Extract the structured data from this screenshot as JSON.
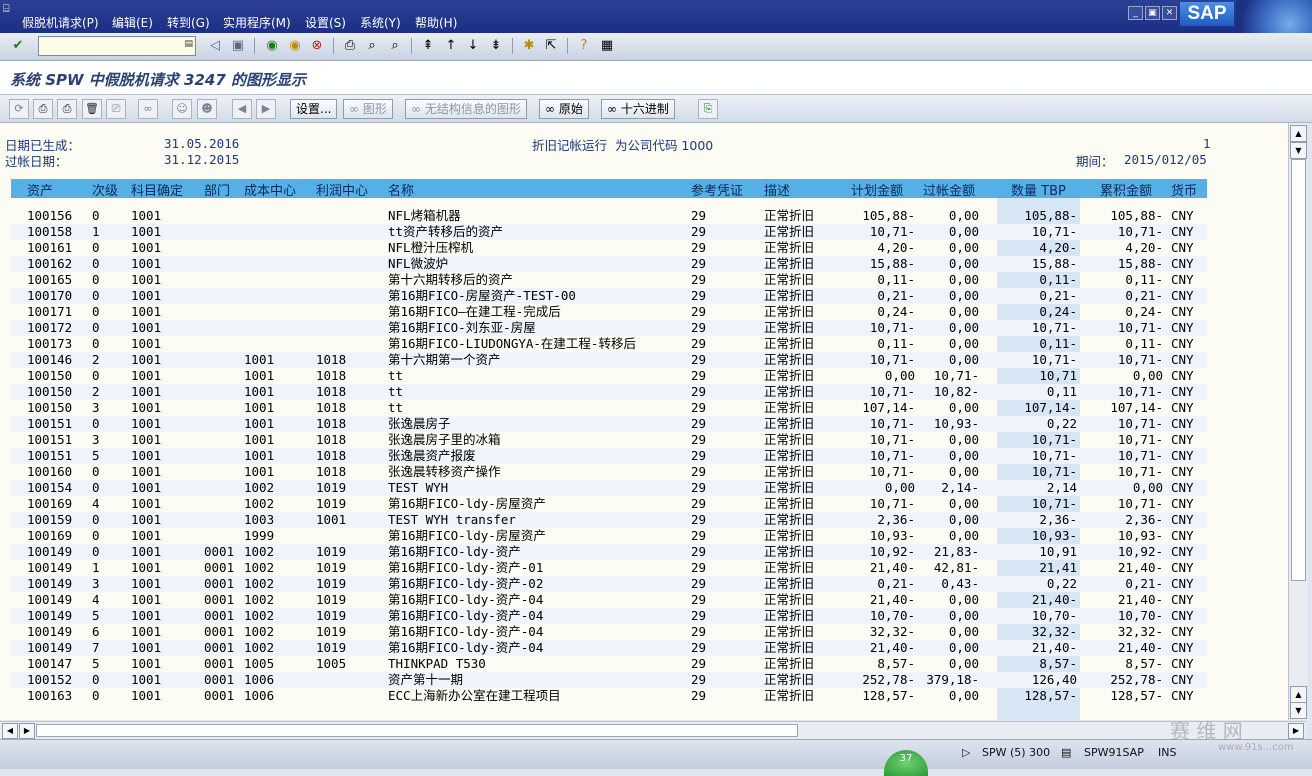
{
  "menu": [
    "假脱机请求(P)",
    "编辑(E)",
    "转到(G)",
    "实用程序(M)",
    "设置(S)",
    "系统(Y)",
    "帮助(H)"
  ],
  "brand": "SAP",
  "command_field": {
    "value": ""
  },
  "page_title": "系统 SPW 中假脱机请求 3247 的图形显示",
  "app_toolbar": {
    "settings": "设置...",
    "graphic": "图形",
    "graphic_no_struct": "无结构信息的图形",
    "raw": "原始",
    "hex": "十六进制"
  },
  "report_header": {
    "created_label": "日期已生成：",
    "created_value": "31.05.2016",
    "posting_label": "过帐日期：",
    "posting_value": "31.12.2015",
    "run_title": "折旧记帐运行  为公司代码 1000",
    "page_no": "1",
    "period_label": "期间：",
    "period_value": "2015/012/05"
  },
  "columns": [
    "资产",
    "次级",
    "科目确定",
    "部门",
    "成本中心",
    "利润中心",
    "名称",
    "参考凭证",
    "描述",
    "计划金额",
    "过帐金额",
    "数量 TBP",
    "累积金额",
    "货币"
  ],
  "rows": [
    [
      "100156",
      "0",
      "1001",
      "",
      "",
      "",
      "NFL烤箱机器",
      "29",
      "正常折旧",
      "105,88-",
      "0,00",
      "105,88-",
      "105,88-",
      "CNY"
    ],
    [
      "100158",
      "1",
      "1001",
      "",
      "",
      "",
      "tt资产转移后的资产",
      "29",
      "正常折旧",
      "10,71-",
      "0,00",
      "10,71-",
      "10,71-",
      "CNY"
    ],
    [
      "100161",
      "0",
      "1001",
      "",
      "",
      "",
      "NFL橙汁压榨机",
      "29",
      "正常折旧",
      "4,20-",
      "0,00",
      "4,20-",
      "4,20-",
      "CNY"
    ],
    [
      "100162",
      "0",
      "1001",
      "",
      "",
      "",
      "NFL微波炉",
      "29",
      "正常折旧",
      "15,88-",
      "0,00",
      "15,88-",
      "15,88-",
      "CNY"
    ],
    [
      "100165",
      "0",
      "1001",
      "",
      "",
      "",
      "第十六期转移后的资产",
      "29",
      "正常折旧",
      "0,11-",
      "0,00",
      "0,11-",
      "0,11-",
      "CNY"
    ],
    [
      "100170",
      "0",
      "1001",
      "",
      "",
      "",
      "第16期FICO-房屋资产-TEST-00",
      "29",
      "正常折旧",
      "0,21-",
      "0,00",
      "0,21-",
      "0,21-",
      "CNY"
    ],
    [
      "100171",
      "0",
      "1001",
      "",
      "",
      "",
      "第16期FICO—在建工程-完成后",
      "29",
      "正常折旧",
      "0,24-",
      "0,00",
      "0,24-",
      "0,24-",
      "CNY"
    ],
    [
      "100172",
      "0",
      "1001",
      "",
      "",
      "",
      "第16期FICO-刘东亚-房屋",
      "29",
      "正常折旧",
      "10,71-",
      "0,00",
      "10,71-",
      "10,71-",
      "CNY"
    ],
    [
      "100173",
      "0",
      "1001",
      "",
      "",
      "",
      "第16期FICO-LIUDONGYA-在建工程-转移后",
      "29",
      "正常折旧",
      "0,11-",
      "0,00",
      "0,11-",
      "0,11-",
      "CNY"
    ],
    [
      "100146",
      "2",
      "1001",
      "",
      "1001",
      "1018",
      "第十六期第一个资产",
      "29",
      "正常折旧",
      "10,71-",
      "0,00",
      "10,71-",
      "10,71-",
      "CNY"
    ],
    [
      "100150",
      "0",
      "1001",
      "",
      "1001",
      "1018",
      "tt",
      "29",
      "正常折旧",
      "0,00",
      "10,71-",
      "10,71",
      "0,00",
      "CNY"
    ],
    [
      "100150",
      "2",
      "1001",
      "",
      "1001",
      "1018",
      "tt",
      "29",
      "正常折旧",
      "10,71-",
      "10,82-",
      "0,11",
      "10,71-",
      "CNY"
    ],
    [
      "100150",
      "3",
      "1001",
      "",
      "1001",
      "1018",
      "tt",
      "29",
      "正常折旧",
      "107,14-",
      "0,00",
      "107,14-",
      "107,14-",
      "CNY"
    ],
    [
      "100151",
      "0",
      "1001",
      "",
      "1001",
      "1018",
      "张逸晨房子",
      "29",
      "正常折旧",
      "10,71-",
      "10,93-",
      "0,22",
      "10,71-",
      "CNY"
    ],
    [
      "100151",
      "3",
      "1001",
      "",
      "1001",
      "1018",
      "张逸晨房子里的冰箱",
      "29",
      "正常折旧",
      "10,71-",
      "0,00",
      "10,71-",
      "10,71-",
      "CNY"
    ],
    [
      "100151",
      "5",
      "1001",
      "",
      "1001",
      "1018",
      "张逸晨资产报废",
      "29",
      "正常折旧",
      "10,71-",
      "0,00",
      "10,71-",
      "10,71-",
      "CNY"
    ],
    [
      "100160",
      "0",
      "1001",
      "",
      "1001",
      "1018",
      "张逸晨转移资产操作",
      "29",
      "正常折旧",
      "10,71-",
      "0,00",
      "10,71-",
      "10,71-",
      "CNY"
    ],
    [
      "100154",
      "0",
      "1001",
      "",
      "1002",
      "1019",
      "TEST WYH",
      "29",
      "正常折旧",
      "0,00",
      "2,14-",
      "2,14",
      "0,00",
      "CNY"
    ],
    [
      "100169",
      "4",
      "1001",
      "",
      "1002",
      "1019",
      "第16期FICO-ldy-房屋资产",
      "29",
      "正常折旧",
      "10,71-",
      "0,00",
      "10,71-",
      "10,71-",
      "CNY"
    ],
    [
      "100159",
      "0",
      "1001",
      "",
      "1003",
      "1001",
      "TEST WYH transfer",
      "29",
      "正常折旧",
      "2,36-",
      "0,00",
      "2,36-",
      "2,36-",
      "CNY"
    ],
    [
      "100169",
      "0",
      "1001",
      "",
      "1999",
      "",
      "第16期FICO-ldy-房屋资产",
      "29",
      "正常折旧",
      "10,93-",
      "0,00",
      "10,93-",
      "10,93-",
      "CNY"
    ],
    [
      "100149",
      "0",
      "1001",
      "0001",
      "1002",
      "1019",
      "第16期FICO-ldy-资产",
      "29",
      "正常折旧",
      "10,92-",
      "21,83-",
      "10,91",
      "10,92-",
      "CNY"
    ],
    [
      "100149",
      "1",
      "1001",
      "0001",
      "1002",
      "1019",
      "第16期FICO-ldy-资产-01",
      "29",
      "正常折旧",
      "21,40-",
      "42,81-",
      "21,41",
      "21,40-",
      "CNY"
    ],
    [
      "100149",
      "3",
      "1001",
      "0001",
      "1002",
      "1019",
      "第16期FICO-ldy-资产-02",
      "29",
      "正常折旧",
      "0,21-",
      "0,43-",
      "0,22",
      "0,21-",
      "CNY"
    ],
    [
      "100149",
      "4",
      "1001",
      "0001",
      "1002",
      "1019",
      "第16期FICO-ldy-资产-04",
      "29",
      "正常折旧",
      "21,40-",
      "0,00",
      "21,40-",
      "21,40-",
      "CNY"
    ],
    [
      "100149",
      "5",
      "1001",
      "0001",
      "1002",
      "1019",
      "第16期FICO-ldy-资产-04",
      "29",
      "正常折旧",
      "10,70-",
      "0,00",
      "10,70-",
      "10,70-",
      "CNY"
    ],
    [
      "100149",
      "6",
      "1001",
      "0001",
      "1002",
      "1019",
      "第16期FICO-ldy-资产-04",
      "29",
      "正常折旧",
      "32,32-",
      "0,00",
      "32,32-",
      "32,32-",
      "CNY"
    ],
    [
      "100149",
      "7",
      "1001",
      "0001",
      "1002",
      "1019",
      "第16期FICO-ldy-资产-04",
      "29",
      "正常折旧",
      "21,40-",
      "0,00",
      "21,40-",
      "21,40-",
      "CNY"
    ],
    [
      "100147",
      "5",
      "1001",
      "0001",
      "1005",
      "1005",
      "THINKPAD T530",
      "29",
      "正常折旧",
      "8,57-",
      "0,00",
      "8,57-",
      "8,57-",
      "CNY"
    ],
    [
      "100152",
      "0",
      "1001",
      "0001",
      "1006",
      "",
      "资产第十一期",
      "29",
      "正常折旧",
      "252,78-",
      "379,18-",
      "126,40",
      "252,78-",
      "CNY"
    ],
    [
      "100163",
      "0",
      "1001",
      "0001",
      "1006",
      "",
      "ECC上海新办公室在建工程项目",
      "29",
      "正常折旧",
      "128,57-",
      "0,00",
      "128,57-",
      "128,57-",
      "CNY"
    ]
  ],
  "status": {
    "system": "SPW (5) 300",
    "server": "SPW91SAP",
    "mode": "INS",
    "badge": "37"
  },
  "watermark": "赛 维 网",
  "watermark_url": "www.91s...com"
}
